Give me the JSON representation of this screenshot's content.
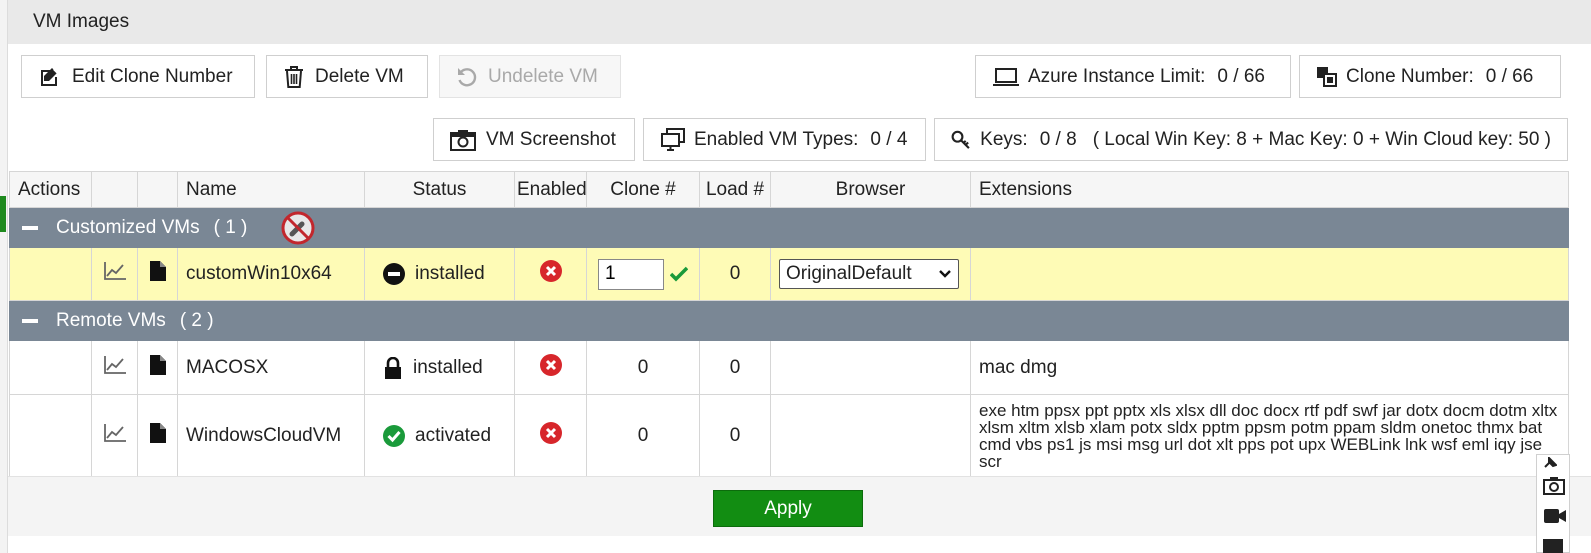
{
  "header": {
    "title": "VM Images"
  },
  "toolbar": {
    "edit_clone_label": "Edit Clone Number",
    "delete_vm_label": "Delete VM",
    "undelete_vm_label": "Undelete VM",
    "vm_screenshot_label": "VM Screenshot"
  },
  "stats": {
    "azure_label": "Azure Instance Limit:",
    "azure_value": "0 / 66",
    "clone_label": "Clone Number:",
    "clone_value": "0 / 66",
    "enabled_types_label": "Enabled VM Types:",
    "enabled_types_value": "0 / 4",
    "keys_label": "Keys:",
    "keys_value": "0 / 8",
    "keys_detail": "( Local Win Key: 8  + Mac Key: 0  + Win Cloud key: 50  )"
  },
  "table": {
    "columns": [
      "Actions",
      "",
      "",
      "Name",
      "Status",
      "Enabled",
      "Clone #",
      "Load #",
      "Browser",
      "Extensions"
    ],
    "groups": [
      {
        "label": "Customized VMs",
        "count": "( 1 )",
        "rows": [
          {
            "name": "customWin10x64",
            "status": "installed",
            "status_icon": "minus-circle-icon",
            "enabled_icon": "x-circle-icon",
            "clone_value": "1",
            "load": "0",
            "browser": "OriginalDefault",
            "extensions": ""
          }
        ]
      },
      {
        "label": "Remote VMs",
        "count": "( 2 )",
        "rows": [
          {
            "name": "MACOSX",
            "status": "installed",
            "status_icon": "lock-icon",
            "enabled_icon": "x-circle-icon",
            "clone": "0",
            "load": "0",
            "browser": "",
            "extensions": "mac dmg"
          },
          {
            "name": "WindowsCloudVM",
            "status": "activated",
            "status_icon": "check-circle-icon",
            "enabled_icon": "x-circle-icon",
            "clone": "0",
            "load": "0",
            "browser": "",
            "extensions": "exe htm ppsx ppt pptx xls xlsx dll doc docx rtf pdf swf jar dotx docm dotm xltx xlsm xltm xlsb xlam potx sldx pptm ppsm potm ppam sldm onetoc thmx bat cmd vbs ps1 js msi msg url dot xlt pps pot upx WEBLink lnk wsf eml iqy jse scr"
          }
        ]
      }
    ]
  },
  "footer": {
    "apply_label": "Apply"
  },
  "colors": {
    "group_bg": "#7a8795",
    "highlight_row": "#fefbb6",
    "apply_green": "#128d12",
    "error_red": "#d7262b",
    "ok_green": "#1a9a3a"
  }
}
